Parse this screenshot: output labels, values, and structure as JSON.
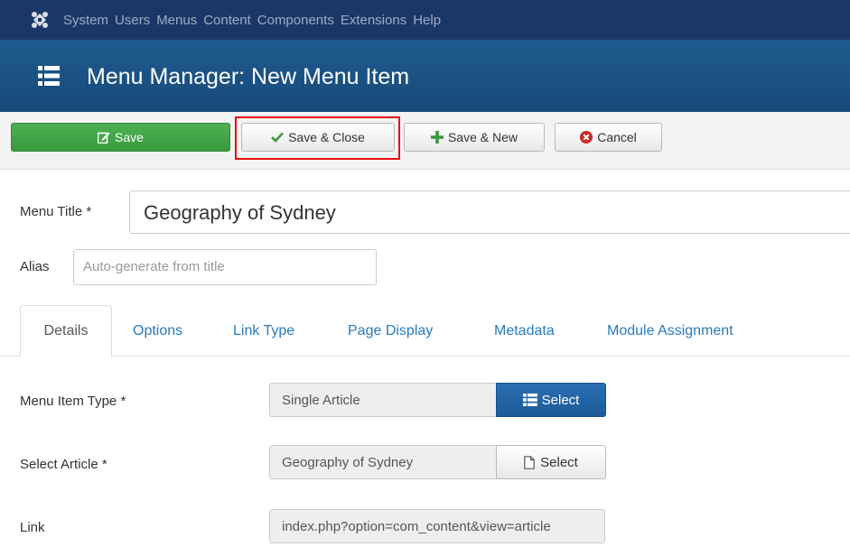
{
  "topnav": {
    "items": [
      "System",
      "Users",
      "Menus",
      "Content",
      "Components",
      "Extensions",
      "Help"
    ]
  },
  "header": {
    "title": "Menu Manager: New Menu Item"
  },
  "toolbar": {
    "save_label": "Save",
    "save_close_label": "Save & Close",
    "save_new_label": "Save & New",
    "cancel_label": "Cancel"
  },
  "form": {
    "menu_title_label": "Menu Title *",
    "menu_title_value": "Geography of Sydney",
    "alias_label": "Alias",
    "alias_placeholder": "Auto-generate from title"
  },
  "tabs": [
    "Details",
    "Options",
    "Link Type",
    "Page Display",
    "Metadata",
    "Module Assignment"
  ],
  "details": {
    "menu_item_type_label": "Menu Item Type *",
    "menu_item_type_value": "Single Article",
    "menu_item_type_button": "Select",
    "select_article_label": "Select Article *",
    "select_article_value": "Geography of Sydney",
    "select_article_button": "Select",
    "link_label": "Link",
    "link_value": "index.php?option=com_content&view=article"
  },
  "colors": {
    "nav_bg": "#1a3867",
    "title_bg": "#1f5b8f",
    "save_green": "#46a84a",
    "select_blue": "#2a6fb3",
    "highlight_red": "#e01010"
  }
}
